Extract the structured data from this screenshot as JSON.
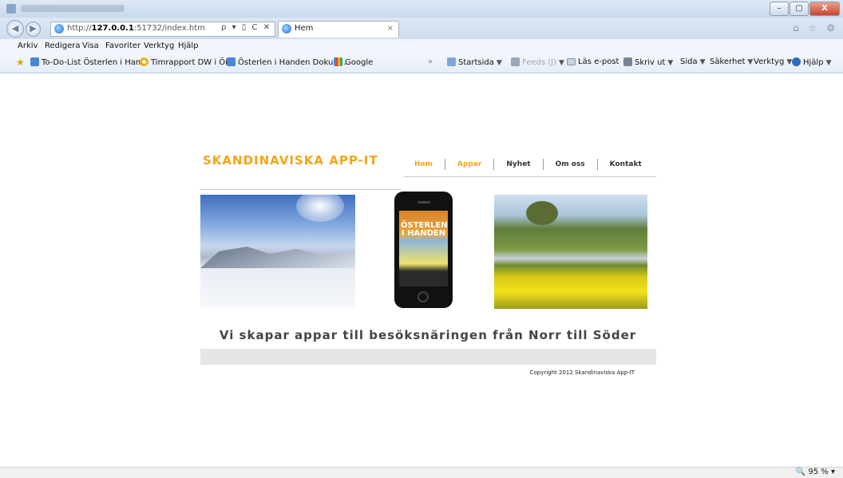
{
  "browser": {
    "address": {
      "prefix": "http://",
      "host": "127.0.0.1",
      "rest": ":51732/index.htm",
      "controls": "ρ ▾ ▯ C ✕"
    },
    "tab": {
      "label": "Hem",
      "close": "×"
    },
    "window_buttons": [
      "–",
      "▢",
      "X"
    ],
    "top_right_icons": "⌂ ☆ ⚙",
    "menu": [
      "Arkiv",
      "Redigera",
      "Visa",
      "Favoriter",
      "Verktyg",
      "Hjälp"
    ],
    "favorites": [
      {
        "label": "To-Do-List Österlen i Han...",
        "icon": "doc-icon"
      },
      {
        "label": "Timrapport DW i ÖiH",
        "icon": "ie-icon"
      },
      {
        "label": "Österlen i Handen Dokum...",
        "icon": "doc-icon"
      },
      {
        "label": "Google",
        "icon": "google-icon"
      }
    ],
    "overflow": "»",
    "commands": {
      "home": "Startsida",
      "feeds": "Feeds (J)",
      "mail": "Läs e-post",
      "print": "Skriv ut",
      "page": "Sida",
      "safety": "Säkerhet",
      "tools": "Verktyg",
      "help": "Hjälp"
    },
    "zoom": "95 %"
  },
  "site": {
    "brand": "SKANDINAVISKA APP-IT",
    "nav": [
      "Hem",
      "Appar",
      "Nyhet",
      "Om oss",
      "Kontakt"
    ],
    "phone_screen": "ÖSTERLEN I HANDEN",
    "tagline": "Vi skapar appar till besöksnäringen från Norr till Söder",
    "copyright": "Copyright 2012 Skandinaviska App-IT",
    "accent": "#f2a51a"
  }
}
